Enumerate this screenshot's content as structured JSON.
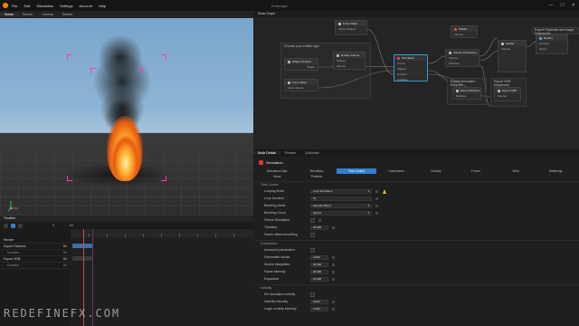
{
  "app": {
    "window_title": "Embergen"
  },
  "menubar": {
    "items": [
      "File",
      "Edit",
      "Simulation",
      "Settings",
      "Account",
      "Help"
    ],
    "controls": [
      "—",
      "☐",
      "✕"
    ]
  },
  "viewport": {
    "tabs": [
      "Scene",
      "Render",
      "Camera",
      "Default"
    ]
  },
  "timeline": {
    "title": "Timeline",
    "frame_start": "0",
    "frame_end": "64",
    "rows": [
      {
        "label": "Render",
        "value": "",
        "sub": false
      },
      {
        "label": "Export Particles",
        "value": "64",
        "sub": false
      },
      {
        "label": "Duration",
        "value": "64",
        "sub": true
      },
      {
        "label": "Export VDB",
        "value": "64",
        "sub": false
      },
      {
        "label": "Duration",
        "value": "64",
        "sub": true
      }
    ]
  },
  "node_graph": {
    "title": "Node Graph",
    "comment": "Choose your emitter type",
    "nodes": [
      {
        "key": "shape",
        "title": "Shape Primitive",
        "props": [
          "Shape"
        ]
      },
      {
        "key": "force",
        "title": "Force Wave",
        "props": [
          "Force Waves"
        ]
      },
      {
        "key": "force2",
        "title": "Force Wave",
        "props": [
          "Vector Shapes"
        ]
      },
      {
        "key": "emitter",
        "title": "Emitter Volume",
        "props": [
          "Shapes",
          "Volume"
        ]
      },
      {
        "key": "sim",
        "title": "Simulation",
        "props": [
          "Forces",
          "Shapes",
          "Emitters",
          "Colliders"
        ]
      },
      {
        "key": "shade",
        "title": "Shader",
        "props": [
          "Volume"
        ]
      },
      {
        "key": "postp",
        "title": "Volume Processing",
        "props": [
          "Volume",
          "Particles"
        ]
      },
      {
        "key": "scatter",
        "title": "Scatter",
        "props": [
          "Volume"
        ]
      },
      {
        "key": "render",
        "title": "Render",
        "props": [
          "Camera",
          "Scene"
        ]
      },
      {
        "key": "exp_part",
        "title": "Export Particles",
        "props": [
          "Particles"
        ]
      },
      {
        "key": "exp_vdb",
        "title": "Export VDB",
        "props": [
          "Volume"
        ]
      },
      {
        "key": "flipbook",
        "title": "Export Flipbooks and image Sequences",
        "props": []
      },
      {
        "key": "exp_anim",
        "title": "Export Simulation Particles",
        "props": []
      },
      {
        "key": "exp_vdb_label",
        "title": "Export VDB sequences",
        "props": []
      }
    ]
  },
  "properties": {
    "tabs": [
      "Node Details",
      "Presets",
      "Quickstart"
    ],
    "node_title": "Simulation",
    "sub_tabs_row1": [
      "Simulation Data",
      "Simulation",
      "Time Control",
      "Combustion",
      "Vorticity",
      "Forces",
      "Wind",
      "Shattering",
      "Break"
    ],
    "sub_tabs_row2": [
      "Visual",
      "Particles"
    ],
    "sections": [
      {
        "title": "Time Control",
        "rows": [
          {
            "label": "Looping Mode",
            "value": "Loop Simulation"
          },
          {
            "label": "Loop Duration",
            "value": "64"
          },
          {
            "label": "Blending Mode",
            "value": "Episodic Blend"
          },
          {
            "label": "Blending Curve",
            "value": "Quintic"
          },
          {
            "label": "Freeze Simulation",
            "value": ""
          },
          {
            "label": "Timestep",
            "value": "30.000"
          },
          {
            "label": "Frame offset smoothing",
            "value": ""
          }
        ]
      },
      {
        "title": "Combustion",
        "rows": [
          {
            "label": "Advanced parameters",
            "value": ""
          },
          {
            "label": "Flammable smoke",
            "value": "0.250"
          },
          {
            "label": "Smoke dissipation",
            "value": "20.000"
          },
          {
            "label": "Flame intensity",
            "value": "20.000"
          },
          {
            "label": "Expansion",
            "value": "10.000"
          }
        ]
      },
      {
        "title": "Vorticity",
        "rows": [
          {
            "label": "Per simulated vorticity",
            "value": ""
          },
          {
            "label": "Vorticity intensity",
            "value": "0.000"
          },
          {
            "label": "Large vorticity intensity",
            "value": "0.400"
          }
        ]
      }
    ]
  },
  "watermark": "REDEFINEFX.COM",
  "colors": {
    "accent": "#2f7fcc",
    "selection": "#2f9bd6",
    "playhead": "#d24a4a",
    "warning": "#f2c200",
    "logo": "#f08a00"
  }
}
